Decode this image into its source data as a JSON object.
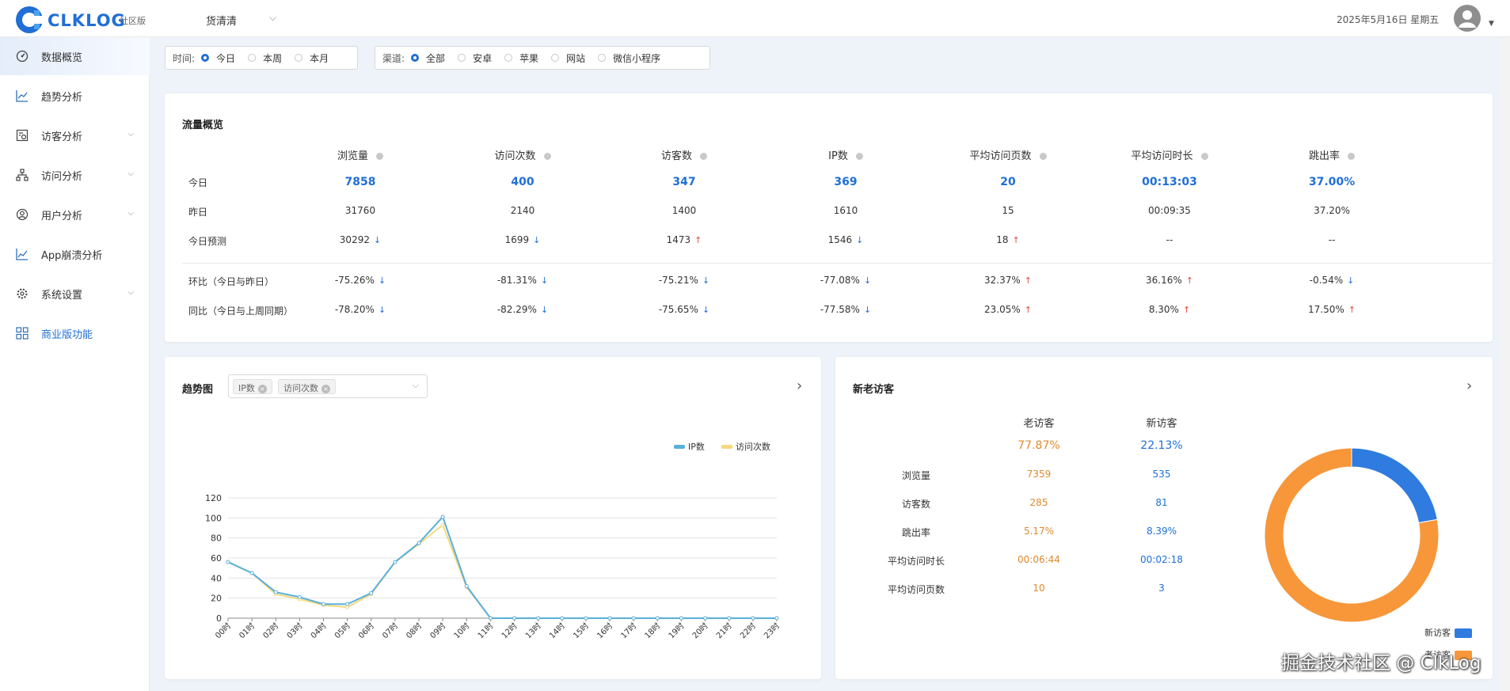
{
  "header": {
    "logo_text": "CLKLOG",
    "edition": "社区版",
    "project": "货清清",
    "date": "2025年5月16日 星期五"
  },
  "sidebar": {
    "items": [
      {
        "label": "数据概览",
        "icon": "dashboard-icon",
        "active": true,
        "has_children": false
      },
      {
        "label": "趋势分析",
        "icon": "line-chart-icon",
        "active": false,
        "has_children": false
      },
      {
        "label": "访客分析",
        "icon": "visitor-icon",
        "active": false,
        "has_children": true
      },
      {
        "label": "访问分析",
        "icon": "sitemap-icon",
        "active": false,
        "has_children": true
      },
      {
        "label": "用户分析",
        "icon": "user-icon",
        "active": false,
        "has_children": true
      },
      {
        "label": "App崩溃分析",
        "icon": "crash-chart-icon",
        "active": false,
        "has_children": false
      },
      {
        "label": "系统设置",
        "icon": "gear-icon",
        "active": false,
        "has_children": true
      },
      {
        "label": "商业版功能",
        "icon": "grid-icon",
        "active": false,
        "has_children": false
      }
    ]
  },
  "filters": {
    "time": {
      "label": "时间:",
      "options": [
        "今日",
        "本周",
        "本月"
      ],
      "selected": "今日"
    },
    "channel": {
      "label": "渠道:",
      "options": [
        "全部",
        "安卓",
        "苹果",
        "网站",
        "微信小程序"
      ],
      "selected": "全部"
    }
  },
  "traffic": {
    "title": "流量概览",
    "columns": [
      "浏览量",
      "访问次数",
      "访客数",
      "IP数",
      "平均访问页数",
      "平均访问时长",
      "跳出率"
    ],
    "rows": [
      {
        "label": "今日",
        "values": [
          "7858",
          "400",
          "347",
          "369",
          "20",
          "00:13:03",
          "37.00%"
        ],
        "arrows": [
          "",
          "",
          "",
          "",
          "",
          "",
          ""
        ],
        "emphasis": true
      },
      {
        "label": "昨日",
        "values": [
          "31760",
          "2140",
          "1400",
          "1610",
          "15",
          "00:09:35",
          "37.20%"
        ],
        "arrows": [
          "",
          "",
          "",
          "",
          "",
          "",
          ""
        ],
        "emphasis": false
      },
      {
        "label": "今日预测",
        "values": [
          "30292",
          "1699",
          "1473",
          "1546",
          "18",
          "--",
          "--"
        ],
        "arrows": [
          "down",
          "down",
          "up",
          "down",
          "up",
          "",
          ""
        ],
        "emphasis": false
      },
      {
        "label": "环比（今日与昨日）",
        "values": [
          "-75.26%",
          "-81.31%",
          "-75.21%",
          "-77.08%",
          "32.37%",
          "36.16%",
          "-0.54%"
        ],
        "arrows": [
          "down",
          "down",
          "down",
          "down",
          "up",
          "up",
          "down"
        ],
        "emphasis": false
      },
      {
        "label": "同比（今日与上周同期）",
        "values": [
          "-78.20%",
          "-82.29%",
          "-75.65%",
          "-77.58%",
          "23.05%",
          "8.30%",
          "17.50%"
        ],
        "arrows": [
          "down",
          "down",
          "down",
          "down",
          "up",
          "up",
          "up"
        ],
        "emphasis": false
      }
    ]
  },
  "trend": {
    "title": "趋势图",
    "chips": [
      "IP数",
      "访问次数"
    ]
  },
  "chart_data": {
    "type": "line",
    "x": [
      "00时",
      "01时",
      "02时",
      "03时",
      "04时",
      "05时",
      "06时",
      "07时",
      "08时",
      "09时",
      "10时",
      "11时",
      "12时",
      "13时",
      "14时",
      "15时",
      "16时",
      "17时",
      "18时",
      "19时",
      "20时",
      "21时",
      "22时",
      "23时"
    ],
    "series": [
      {
        "name": "IP数",
        "color": "#5aafdc",
        "values": [
          56,
          45,
          26,
          21,
          14,
          14,
          25,
          56,
          75,
          101,
          32,
          0,
          0,
          0,
          0,
          0,
          0,
          0,
          0,
          0,
          0,
          0,
          0,
          0
        ]
      },
      {
        "name": "访问次数",
        "color": "#f5d97e",
        "values": [
          56,
          45,
          24,
          19,
          13,
          11,
          24,
          56,
          74,
          93,
          31,
          0,
          0,
          0,
          0,
          0,
          0,
          0,
          0,
          0,
          0,
          0,
          0,
          0
        ]
      }
    ],
    "ylim": [
      0,
      120
    ],
    "yticks": [
      0,
      20,
      40,
      60,
      80,
      100,
      120
    ],
    "legend": "top-right",
    "grid": true
  },
  "visitors": {
    "title": "新老访客",
    "old_label": "老访客",
    "new_label": "新访客",
    "old_pct": "77.87%",
    "new_pct": "22.13%",
    "rows": [
      {
        "label": "浏览量",
        "old": "7359",
        "new": "535"
      },
      {
        "label": "访客数",
        "old": "285",
        "new": "81"
      },
      {
        "label": "跳出率",
        "old": "5.17%",
        "new": "8.39%"
      },
      {
        "label": "平均访问时长",
        "old": "00:06:44",
        "new": "00:02:18"
      },
      {
        "label": "平均访问页数",
        "old": "10",
        "new": "3"
      }
    ],
    "donut": {
      "new_share": 22.13,
      "old_share": 77.87,
      "new_color": "#2f7be0",
      "old_color": "#f7973a"
    },
    "legend": [
      {
        "label": "新访客",
        "color": "#2f7be0"
      },
      {
        "label": "老访客",
        "color": "#f7973a"
      }
    ]
  },
  "watermark": "掘金技术社区 @ ClkLog"
}
